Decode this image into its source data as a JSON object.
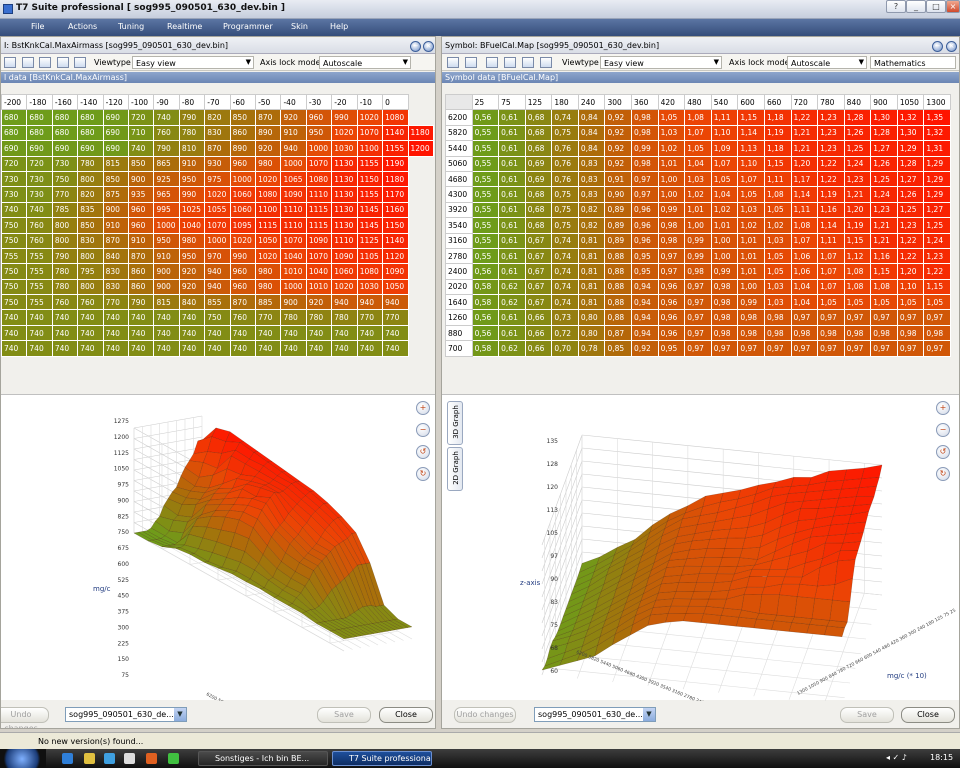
{
  "window": {
    "title": "T7 Suite professional [ sog995_090501_630_dev.bin ]"
  },
  "menu": [
    "File",
    "Actions",
    "Tuning",
    "Realtime",
    "Programmer",
    "Skin",
    "Help"
  ],
  "left_panel": {
    "header": "I: BstKnkCal.MaxAirmass [sog995_090501_630_dev.bin]",
    "viewtype_label": "Viewtype",
    "viewtype_value": "Easy view",
    "axis_lock_label": "Axis lock mode",
    "axis_lock_value": "Autoscale",
    "strip": "l data [BstKnkCal.MaxAirmass]",
    "x_axis": [
      "-200",
      "-180",
      "-160",
      "-140",
      "-120",
      "-100",
      "-90",
      "-80",
      "-70",
      "-60",
      "-50",
      "-40",
      "-30",
      "-20",
      "-10",
      "0"
    ],
    "rows": [
      [
        "680",
        "680",
        "680",
        "680",
        "690",
        "720",
        "740",
        "790",
        "820",
        "850",
        "870",
        "920",
        "960",
        "990",
        "1020",
        "1080"
      ],
      [
        "680",
        "680",
        "680",
        "680",
        "690",
        "710",
        "760",
        "780",
        "830",
        "860",
        "890",
        "910",
        "950",
        "1020",
        "1070",
        "1140",
        "1180"
      ],
      [
        "690",
        "690",
        "690",
        "690",
        "690",
        "740",
        "790",
        "810",
        "870",
        "890",
        "920",
        "940",
        "1000",
        "1030",
        "1100",
        "1155",
        "1200"
      ],
      [
        "720",
        "720",
        "730",
        "780",
        "815",
        "850",
        "865",
        "910",
        "930",
        "960",
        "980",
        "1000",
        "1070",
        "1130",
        "1155",
        "1190"
      ],
      [
        "730",
        "730",
        "750",
        "800",
        "850",
        "900",
        "925",
        "950",
        "975",
        "1000",
        "1020",
        "1065",
        "1080",
        "1130",
        "1150",
        "1180"
      ],
      [
        "730",
        "730",
        "770",
        "820",
        "875",
        "935",
        "965",
        "990",
        "1020",
        "1060",
        "1080",
        "1090",
        "1110",
        "1130",
        "1155",
        "1170"
      ],
      [
        "740",
        "740",
        "785",
        "835",
        "900",
        "960",
        "995",
        "1025",
        "1055",
        "1060",
        "1100",
        "1110",
        "1115",
        "1130",
        "1145",
        "1160"
      ],
      [
        "750",
        "760",
        "800",
        "850",
        "910",
        "960",
        "1000",
        "1040",
        "1070",
        "1095",
        "1115",
        "1110",
        "1115",
        "1130",
        "1145",
        "1150"
      ],
      [
        "750",
        "760",
        "800",
        "830",
        "870",
        "910",
        "950",
        "980",
        "1000",
        "1020",
        "1050",
        "1070",
        "1090",
        "1110",
        "1125",
        "1140"
      ],
      [
        "755",
        "755",
        "790",
        "800",
        "840",
        "870",
        "910",
        "950",
        "970",
        "990",
        "1020",
        "1040",
        "1070",
        "1090",
        "1105",
        "1120"
      ],
      [
        "750",
        "755",
        "780",
        "795",
        "830",
        "860",
        "900",
        "920",
        "940",
        "960",
        "980",
        "1010",
        "1040",
        "1060",
        "1080",
        "1090"
      ],
      [
        "750",
        "755",
        "780",
        "800",
        "830",
        "860",
        "900",
        "920",
        "940",
        "960",
        "980",
        "1000",
        "1010",
        "1020",
        "1030",
        "1050"
      ],
      [
        "750",
        "755",
        "760",
        "760",
        "770",
        "790",
        "815",
        "840",
        "855",
        "870",
        "885",
        "900",
        "920",
        "940",
        "940",
        "940"
      ],
      [
        "740",
        "740",
        "740",
        "740",
        "740",
        "740",
        "740",
        "740",
        "750",
        "760",
        "770",
        "780",
        "780",
        "780",
        "770",
        "770"
      ],
      [
        "740",
        "740",
        "740",
        "740",
        "740",
        "740",
        "740",
        "740",
        "740",
        "740",
        "740",
        "740",
        "740",
        "740",
        "740",
        "740"
      ],
      [
        "740",
        "740",
        "740",
        "740",
        "740",
        "740",
        "740",
        "740",
        "740",
        "740",
        "740",
        "740",
        "740",
        "740",
        "740",
        "740"
      ]
    ],
    "graph": {
      "z_ticks": [
        "1275",
        "1200",
        "1125",
        "1050",
        "975",
        "900",
        "825",
        "750",
        "675",
        "600",
        "525",
        "450",
        "375",
        "300",
        "225",
        "150",
        "75"
      ],
      "z_label": "mg/c",
      "y_label": "y-axis",
      "y_ticks": "6200 5820 5440 5060 4680 4300 3920 3540 3160 2780 2400 2020 1640 1260 880 700"
    },
    "undo_label": "Undo changes",
    "file_combo": "sog995_090501_630_de...",
    "save_label": "Save",
    "close_label": "Close"
  },
  "right_panel": {
    "header": "Symbol: BFuelCal.Map [sog995_090501_630_dev.bin]",
    "viewtype_label": "Viewtype",
    "viewtype_value": "Easy view",
    "axis_lock_label": "Axis lock mode",
    "axis_lock_value": "Autoscale",
    "math_value": "Mathematics",
    "strip": "Symbol data [BFuelCal.Map]",
    "x_axis": [
      "25",
      "75",
      "125",
      "180",
      "240",
      "300",
      "360",
      "420",
      "480",
      "540",
      "600",
      "660",
      "720",
      "780",
      "840",
      "900",
      "1050",
      "1300"
    ],
    "y_axis": [
      "6200",
      "5820",
      "5440",
      "5060",
      "4680",
      "4300",
      "3920",
      "3540",
      "3160",
      "2780",
      "2400",
      "2020",
      "1640",
      "1260",
      "880",
      "700"
    ],
    "rows": [
      [
        "0,56",
        "0,61",
        "0,68",
        "0,74",
        "0,84",
        "0,92",
        "0,98",
        "1,05",
        "1,08",
        "1,11",
        "1,15",
        "1,18",
        "1,22",
        "1,23",
        "1,28",
        "1,30",
        "1,32",
        "1,35"
      ],
      [
        "0,55",
        "0,61",
        "0,68",
        "0,75",
        "0,84",
        "0,92",
        "0,98",
        "1,03",
        "1,07",
        "1,10",
        "1,14",
        "1,19",
        "1,21",
        "1,23",
        "1,26",
        "1,28",
        "1,30",
        "1,32"
      ],
      [
        "0,55",
        "0,61",
        "0,68",
        "0,76",
        "0,84",
        "0,92",
        "0,99",
        "1,02",
        "1,05",
        "1,09",
        "1,13",
        "1,18",
        "1,21",
        "1,23",
        "1,25",
        "1,27",
        "1,29",
        "1,31"
      ],
      [
        "0,55",
        "0,61",
        "0,69",
        "0,76",
        "0,83",
        "0,92",
        "0,98",
        "1,01",
        "1,04",
        "1,07",
        "1,10",
        "1,15",
        "1,20",
        "1,22",
        "1,24",
        "1,26",
        "1,28",
        "1,29"
      ],
      [
        "0,55",
        "0,61",
        "0,69",
        "0,76",
        "0,83",
        "0,91",
        "0,97",
        "1,00",
        "1,03",
        "1,05",
        "1,07",
        "1,11",
        "1,17",
        "1,22",
        "1,23",
        "1,25",
        "1,27",
        "1,29"
      ],
      [
        "0,55",
        "0,61",
        "0,68",
        "0,75",
        "0,83",
        "0,90",
        "0,97",
        "1,00",
        "1,02",
        "1,04",
        "1,05",
        "1,08",
        "1,14",
        "1,19",
        "1,21",
        "1,24",
        "1,26",
        "1,29"
      ],
      [
        "0,55",
        "0,61",
        "0,68",
        "0,75",
        "0,82",
        "0,89",
        "0,96",
        "0,99",
        "1,01",
        "1,02",
        "1,03",
        "1,05",
        "1,11",
        "1,16",
        "1,20",
        "1,23",
        "1,25",
        "1,27"
      ],
      [
        "0,55",
        "0,61",
        "0,68",
        "0,75",
        "0,82",
        "0,89",
        "0,96",
        "0,98",
        "1,00",
        "1,01",
        "1,02",
        "1,02",
        "1,08",
        "1,14",
        "1,19",
        "1,21",
        "1,23",
        "1,25"
      ],
      [
        "0,55",
        "0,61",
        "0,67",
        "0,74",
        "0,81",
        "0,89",
        "0,96",
        "0,98",
        "0,99",
        "1,00",
        "1,01",
        "1,03",
        "1,07",
        "1,11",
        "1,15",
        "1,21",
        "1,22",
        "1,24"
      ],
      [
        "0,55",
        "0,61",
        "0,67",
        "0,74",
        "0,81",
        "0,88",
        "0,95",
        "0,97",
        "0,99",
        "1,00",
        "1,01",
        "1,05",
        "1,06",
        "1,07",
        "1,12",
        "1,16",
        "1,22",
        "1,23"
      ],
      [
        "0,56",
        "0,61",
        "0,67",
        "0,74",
        "0,81",
        "0,88",
        "0,95",
        "0,97",
        "0,98",
        "0,99",
        "1,01",
        "1,05",
        "1,06",
        "1,07",
        "1,08",
        "1,15",
        "1,20",
        "1,22"
      ],
      [
        "0,58",
        "0,62",
        "0,67",
        "0,74",
        "0,81",
        "0,88",
        "0,94",
        "0,96",
        "0,97",
        "0,98",
        "1,00",
        "1,03",
        "1,04",
        "1,07",
        "1,08",
        "1,08",
        "1,10",
        "1,15"
      ],
      [
        "0,58",
        "0,62",
        "0,67",
        "0,74",
        "0,81",
        "0,88",
        "0,94",
        "0,96",
        "0,97",
        "0,98",
        "0,99",
        "1,03",
        "1,04",
        "1,05",
        "1,05",
        "1,05",
        "1,05",
        "1,05"
      ],
      [
        "0,56",
        "0,61",
        "0,66",
        "0,73",
        "0,80",
        "0,88",
        "0,94",
        "0,96",
        "0,97",
        "0,98",
        "0,98",
        "0,98",
        "0,97",
        "0,97",
        "0,97",
        "0,97",
        "0,97",
        "0,97"
      ],
      [
        "0,56",
        "0,61",
        "0,66",
        "0,72",
        "0,80",
        "0,87",
        "0,94",
        "0,96",
        "0,97",
        "0,98",
        "0,98",
        "0,98",
        "0,98",
        "0,98",
        "0,98",
        "0,98",
        "0,98",
        "0,98"
      ],
      [
        "0,58",
        "0,62",
        "0,66",
        "0,70",
        "0,78",
        "0,85",
        "0,92",
        "0,95",
        "0,97",
        "0,97",
        "0,97",
        "0,97",
        "0,97",
        "0,97",
        "0,97",
        "0,97",
        "0,97",
        "0,97"
      ]
    ],
    "graph": {
      "z_ticks": [
        "135",
        "128",
        "120",
        "113",
        "105",
        "97",
        "90",
        "83",
        "75",
        "68",
        "60"
      ],
      "z_label": "z-axis",
      "x_label": "mg/c (* 10)",
      "y_ticks": "6200 5820 5440 5060 4680 4300 3920 3540 3160 2780 2400 2020 1640 1260 880 700",
      "x_ticks": "1300 1050 900 840 780 720 660 600 540 480 420 360 300 240 180 125 75 25"
    },
    "tab_3d": "3D Graph",
    "tab_2d": "2D Graph",
    "undo_label": "Undo changes",
    "file_combo": "sog995_090501_630_de...",
    "save_label": "Save",
    "close_label": "Close"
  },
  "status": "No new version(s) found...",
  "taskbar": {
    "tasks": [
      "Sonstiges - Ich bin BE...",
      "T7 Suite professional ..."
    ],
    "clock": "18:15"
  },
  "colors": {
    "menubar": "#3f5785",
    "strip": "#7a93c0",
    "low": "#6f9a1a",
    "high": "#ff1e00"
  }
}
